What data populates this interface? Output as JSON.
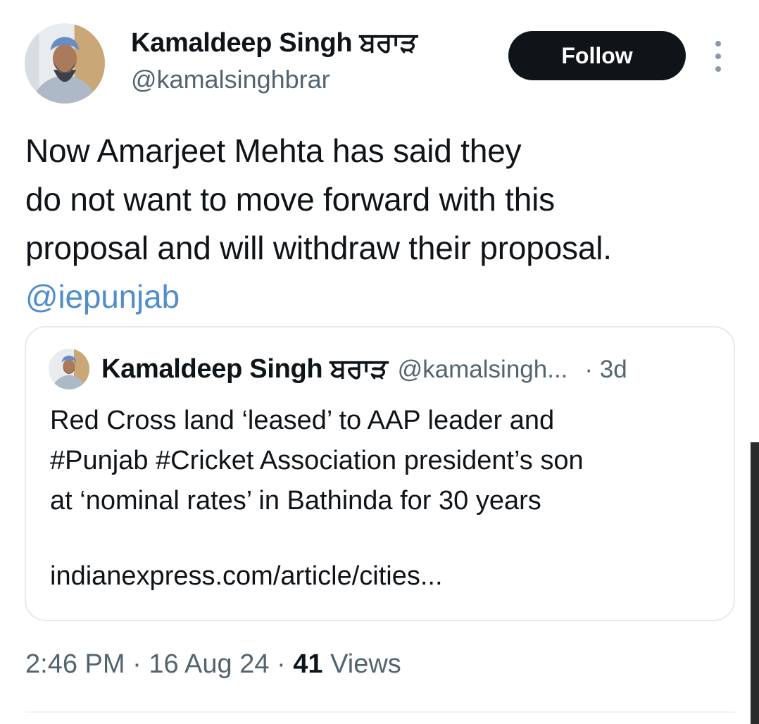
{
  "tweet": {
    "author": {
      "name": "Kamaldeep Singh ਬਰਾੜ",
      "handle": "@kamalsinghbrar"
    },
    "follow_label": "Follow",
    "text_lines": [
      "Now Amarjeet Mehta has said they",
      "do not want to move forward with this",
      "proposal and will withdraw their proposal."
    ],
    "mention": "@iepunjab",
    "time": "2:46 PM",
    "date": "16 Aug 24",
    "views_count": "41",
    "views_label": "Views",
    "separator": "·"
  },
  "quoted_tweet": {
    "name": "Kamaldeep Singh ਬਰਾੜ",
    "handle": "@kamalsingh...",
    "age": "· 3d",
    "text_lines": [
      "Red Cross land ‘leased’ to AAP leader and",
      "#Punjab #Cricket Association president’s son",
      "at ‘nominal rates’ in Bathinda for 30 years"
    ],
    "link": "indianexpress.com/article/cities..."
  },
  "icons": {
    "more": "more-vertical-icon",
    "avatar": "profile-photo"
  },
  "colors": {
    "follow_button_bg": "#0f1419",
    "mention": "#4f8dcc",
    "secondary_text": "#536471"
  }
}
